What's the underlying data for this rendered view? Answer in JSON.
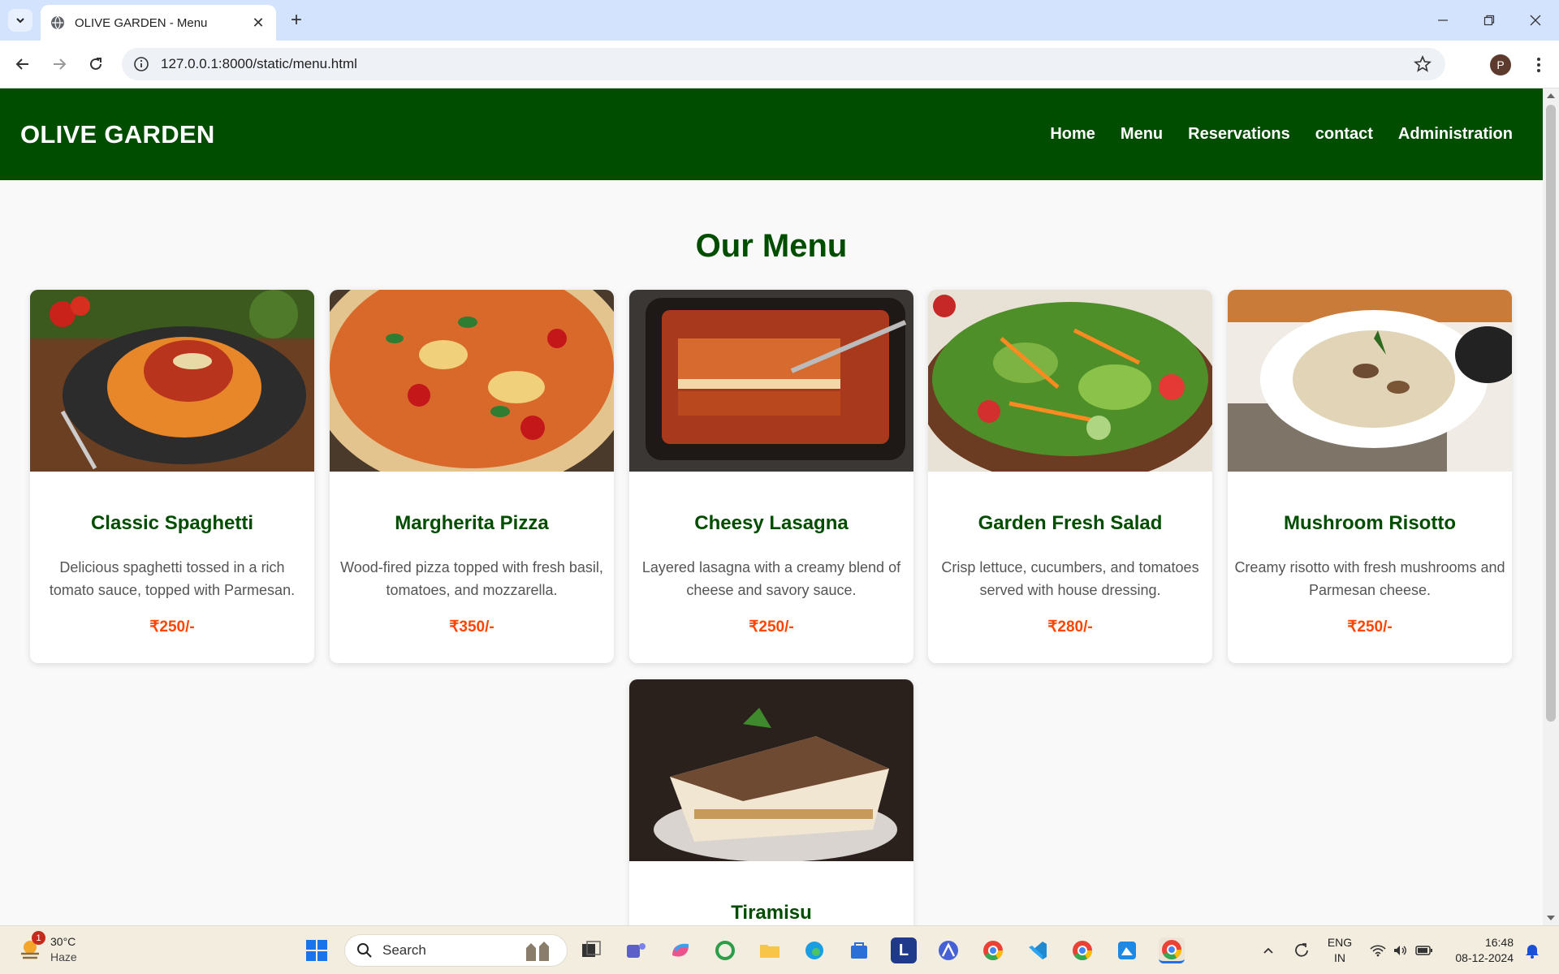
{
  "browser": {
    "tab_title": "OLIVE GARDEN - Menu",
    "url": "127.0.0.1:8000/static/menu.html",
    "profile_initial": "P"
  },
  "site": {
    "logo": "OLIVE GARDEN",
    "nav": [
      "Home",
      "Menu",
      "Reservations",
      "contact",
      "Administration"
    ],
    "page_title": "Our Menu"
  },
  "menu_items": [
    {
      "name": "Classic Spaghetti",
      "description": "Delicious spaghetti tossed in a rich tomato sauce, topped with Parmesan.",
      "price": "₹250/-"
    },
    {
      "name": "Margherita Pizza",
      "description": "Wood-fired pizza topped with fresh basil, tomatoes, and mozzarella.",
      "price": "₹350/-"
    },
    {
      "name": "Cheesy Lasagna",
      "description": "Layered lasagna with a creamy blend of cheese and savory sauce.",
      "price": "₹250/-"
    },
    {
      "name": "Garden Fresh Salad",
      "description": "Crisp lettuce, cucumbers, and tomatoes served with house dressing.",
      "price": "₹280/-"
    },
    {
      "name": "Mushroom Risotto",
      "description": "Creamy risotto with fresh mushrooms and Parmesan cheese.",
      "price": "₹250/-"
    },
    {
      "name": "Tiramisu"
    }
  ],
  "taskbar": {
    "weather_temp": "30°C",
    "weather_cond": "Haze",
    "weather_badge": "1",
    "search_placeholder": "Search",
    "lang_line1": "ENG",
    "lang_line2": "IN",
    "time": "16:48",
    "date": "08-12-2024"
  },
  "colors": {
    "header_bg": "#004d00",
    "title_green": "#004d00",
    "price_orange": "#ff4500"
  }
}
